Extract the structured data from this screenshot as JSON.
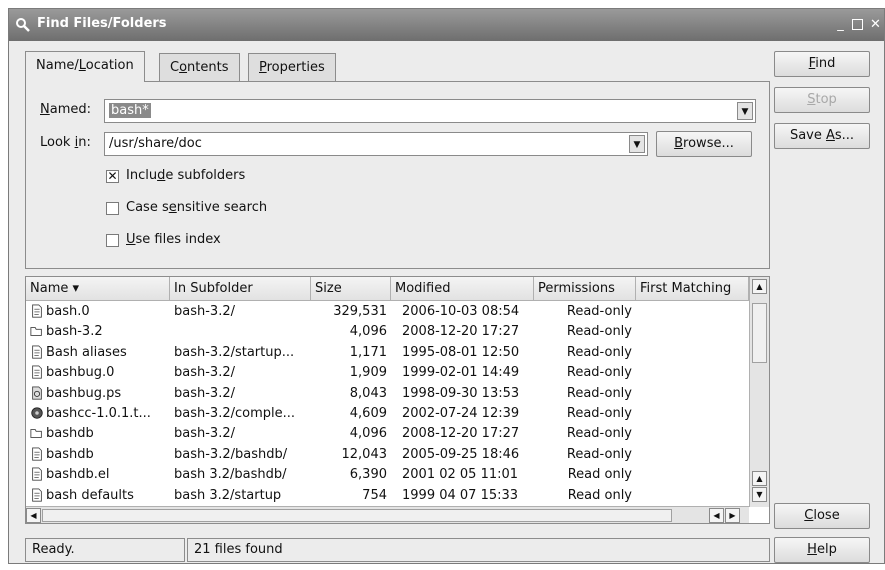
{
  "window": {
    "title": "Find Files/Folders"
  },
  "tabs": [
    {
      "pre": "Name/",
      "u": "L",
      "post": "ocation"
    },
    {
      "pre": "C",
      "u": "o",
      "post": "ntents"
    },
    {
      "pre": "",
      "u": "P",
      "post": "roperties"
    }
  ],
  "named": {
    "label_u": "N",
    "label_rest": "amed:",
    "value": "bash*"
  },
  "look_in": {
    "label_pre": "Look ",
    "label_u": "i",
    "label_post": "n:",
    "value": "/usr/share/doc"
  },
  "browse": {
    "u": "B",
    "rest": "rowse..."
  },
  "options": [
    {
      "pre": "Inclu",
      "u": "d",
      "post": "e subfolders",
      "checked": true
    },
    {
      "pre": "Case s",
      "u": "e",
      "post": "nsitive search",
      "checked": false
    },
    {
      "pre": "",
      "u": "U",
      "post": "se files index",
      "checked": false
    }
  ],
  "side_buttons": {
    "find": {
      "u": "F",
      "rest": "ind"
    },
    "stop": {
      "u": "S",
      "rest": "top"
    },
    "save_as": {
      "pre": "Save ",
      "u": "A",
      "post": "s..."
    },
    "close": {
      "u": "C",
      "rest": "lose"
    },
    "help": {
      "u": "H",
      "rest": "elp"
    }
  },
  "columns": [
    "Name",
    "In Subfolder",
    "Size",
    "Modified",
    "Permissions",
    "First Matching"
  ],
  "sort_indicator": "▾",
  "rows": [
    {
      "icon": "text-file-icon",
      "name": "bash.0",
      "subfolder": "bash-3.2/",
      "size": "329,531",
      "modified": "2006-10-03 08:54",
      "perm": "Read-only"
    },
    {
      "icon": "folder-icon",
      "name": "bash-3.2",
      "subfolder": "",
      "size": "4,096",
      "modified": "2008-12-20 17:27",
      "perm": "Read-only"
    },
    {
      "icon": "text-file-icon",
      "name": "Bash aliases",
      "subfolder": "bash-3.2/startup...",
      "size": "1,171",
      "modified": "1995-08-01 12:50",
      "perm": "Read-only"
    },
    {
      "icon": "text-file-icon",
      "name": "bashbug.0",
      "subfolder": "bash-3.2/",
      "size": "1,909",
      "modified": "1999-02-01 14:49",
      "perm": "Read-only"
    },
    {
      "icon": "postscript-file-icon",
      "name": "bashbug.ps",
      "subfolder": "bash-3.2/",
      "size": "8,043",
      "modified": "1998-09-30 13:53",
      "perm": "Read-only"
    },
    {
      "icon": "archive-file-icon",
      "name": "bashcc-1.0.1.t...",
      "subfolder": "bash-3.2/comple...",
      "size": "4,609",
      "modified": "2002-07-24 12:39",
      "perm": "Read-only"
    },
    {
      "icon": "folder-icon",
      "name": "bashdb",
      "subfolder": "bash-3.2/",
      "size": "4,096",
      "modified": "2008-12-20 17:27",
      "perm": "Read-only"
    },
    {
      "icon": "text-file-icon",
      "name": "bashdb",
      "subfolder": "bash-3.2/bashdb/",
      "size": "12,043",
      "modified": "2005-09-25 18:46",
      "perm": "Read-only"
    },
    {
      "icon": "text-file-icon",
      "name": "bashdb.el",
      "subfolder": "bash 3.2/bashdb/",
      "size": "6,390",
      "modified": "2001 02 05 11:01",
      "perm": "Read only"
    },
    {
      "icon": "text-file-icon",
      "name": "bash defaults",
      "subfolder": "bash 3.2/startup",
      "size": "754",
      "modified": "1999 04 07 15:33",
      "perm": "Read only"
    }
  ],
  "status": {
    "left": "Ready.",
    "right": "21 files found"
  }
}
